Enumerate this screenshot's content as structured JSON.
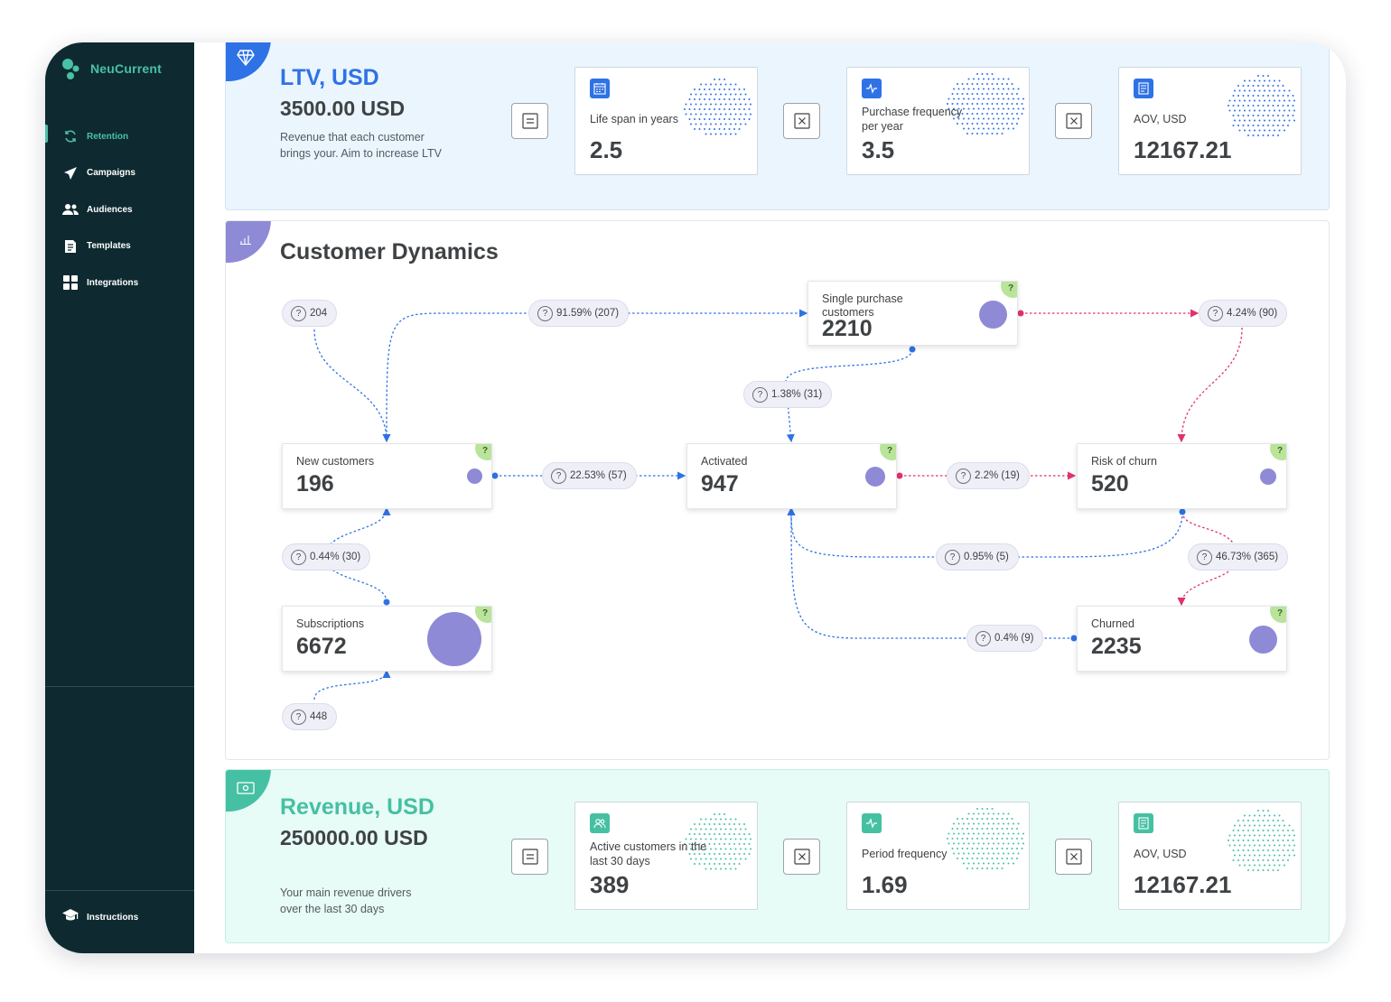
{
  "app": {
    "name": "NeuCurrent"
  },
  "sidebar": {
    "items": [
      {
        "label": "Retention",
        "icon": "retention-icon",
        "active": true
      },
      {
        "label": "Campaigns",
        "icon": "send-icon",
        "active": false
      },
      {
        "label": "Audiences",
        "icon": "users-icon",
        "active": false
      },
      {
        "label": "Templates",
        "icon": "document-icon",
        "active": false
      },
      {
        "label": "Integrations",
        "icon": "grid-icon",
        "active": false
      }
    ],
    "footer": {
      "label": "Instructions",
      "icon": "graduation-cap-icon"
    }
  },
  "ltv": {
    "icon": "diamond-icon",
    "title": "LTV, USD",
    "value": "3500.00 USD",
    "description": "Revenue that each customer brings your. Aim to increase LTV",
    "accent": "#2f72e6",
    "operators": [
      "equals-icon",
      "multiply-icon",
      "multiply-icon"
    ],
    "metrics": [
      {
        "icon": "calendar-icon",
        "label": "Life span in years",
        "value": "2.5"
      },
      {
        "icon": "pulse-icon",
        "label": "Purchase frequency per year",
        "value": "3.5"
      },
      {
        "icon": "receipt-icon",
        "label": "AOV, USD",
        "value": "12167.21"
      }
    ]
  },
  "dynamics": {
    "icon": "bar-chart-icon",
    "title": "Customer Dynamics",
    "accent": "#8f8ad6",
    "colors": {
      "positive": "#2f72e6",
      "negative": "#e0326e",
      "node": "#8f8ad6",
      "help": "#b9e49a"
    },
    "nodes": {
      "single": {
        "label": "Single purchase customers",
        "value": "2210"
      },
      "new": {
        "label": "New customers",
        "value": "196"
      },
      "activated": {
        "label": "Activated",
        "value": "947"
      },
      "risk": {
        "label": "Risk of churn",
        "value": "520"
      },
      "subscriptions": {
        "label": "Subscriptions",
        "value": "6672"
      },
      "churned": {
        "label": "Churned",
        "value": "2235"
      }
    },
    "help_mark": "?",
    "transitions": {
      "incoming_new": "204",
      "new_to_single": "91.59% (207)",
      "single_to_risk": "4.24% (90)",
      "single_to_activated": "1.38% (31)",
      "new_to_activated": "22.53% (57)",
      "activated_to_risk": "2.2% (19)",
      "subscriptions_to_new": "0.44% (30)",
      "risk_to_activated": "0.95% (5)",
      "risk_to_churned": "46.73% (365)",
      "churned_to_activated": "0.4% (9)",
      "incoming_subscriptions": "448"
    }
  },
  "revenue": {
    "icon": "cash-icon",
    "title": "Revenue, USD",
    "value": "250000.00 USD",
    "description": "Your main revenue drivers over the last 30 days",
    "accent": "#46c0a3",
    "operators": [
      "equals-icon",
      "multiply-icon",
      "multiply-icon"
    ],
    "metrics": [
      {
        "icon": "users-icon",
        "label": "Active customers in the last 30 days",
        "value": "389"
      },
      {
        "icon": "pulse-icon",
        "label": "Period frequency",
        "value": "1.69"
      },
      {
        "icon": "receipt-icon",
        "label": "AOV, USD",
        "value": "12167.21"
      }
    ]
  }
}
